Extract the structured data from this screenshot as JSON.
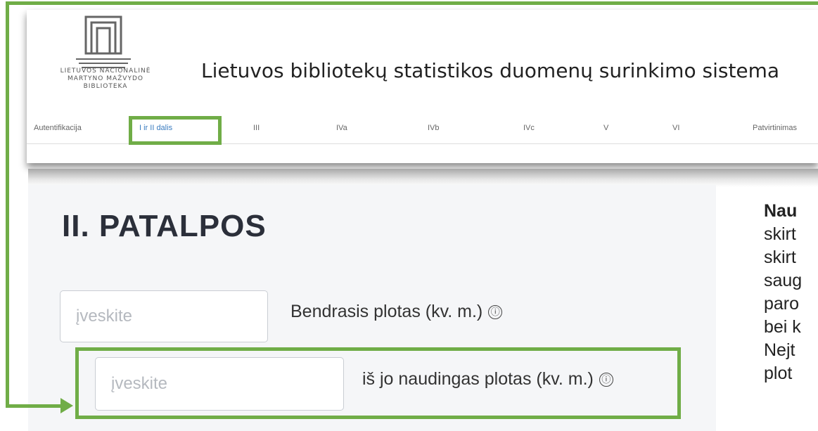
{
  "header": {
    "logo_lines": [
      "LIETUVOS NACIONALINĖ",
      "MARTYNO MAŽVYDO",
      "BIBLIOTEKA"
    ],
    "title": "Lietuvos bibliotekų statistikos duomenų surinkimo sistema"
  },
  "nav": {
    "items": [
      "Autentifikacija",
      "I ir II dalis",
      "III",
      "IVa",
      "IVb",
      "IVc",
      "V",
      "VI",
      "Patvirtinimas"
    ],
    "active_index": 1
  },
  "form": {
    "section_title": "II. PATALPOS",
    "fields": [
      {
        "placeholder": "įveskite",
        "label": "Bendrasis plotas (kv. m.)",
        "info_icon": "ⓘ"
      },
      {
        "placeholder": "įveskite",
        "label": "iš jo naudingas plotas (kv. m.)",
        "info_icon": "ⓘ"
      }
    ]
  },
  "side_text": {
    "lines": [
      "Nau",
      "skirt",
      "skirt",
      "saug",
      "paro",
      "bei k",
      "Nejt",
      "plot"
    ]
  },
  "annotation_color": "#70ad47"
}
